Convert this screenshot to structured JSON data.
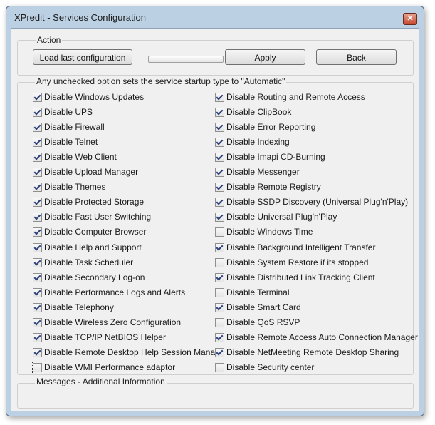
{
  "window": {
    "title": "XPredit - Services Configuration",
    "close_glyph": "✕"
  },
  "action_group": {
    "label": "Action",
    "load_label": "Load last configuration",
    "progress": 0,
    "apply_label": "Apply",
    "back_label": "Back"
  },
  "options_group": {
    "label": "Any unchecked option sets the service startup type to \"Automatic\""
  },
  "left_options": [
    {
      "label": "Disable Windows Updates",
      "checked": true
    },
    {
      "label": "Disable UPS",
      "checked": true
    },
    {
      "label": "Disable Firewall",
      "checked": true
    },
    {
      "label": "Disable Telnet",
      "checked": true
    },
    {
      "label": " Disable Web Client",
      "checked": true
    },
    {
      "label": "Disable Upload Manager",
      "checked": true
    },
    {
      "label": "Disable Themes",
      "checked": true
    },
    {
      "label": "Disable Protected Storage",
      "checked": true
    },
    {
      "label": " Disable Fast User Switching",
      "checked": true
    },
    {
      "label": "Disable Computer Browser",
      "checked": true
    },
    {
      "label": "Disable Help and Support",
      "checked": true
    },
    {
      "label": "Disable Task Scheduler",
      "checked": true
    },
    {
      "label": "Disable Secondary Log-on",
      "checked": true
    },
    {
      "label": "Disable Performance Logs and Alerts",
      "checked": true
    },
    {
      "label": "Disable Telephony",
      "checked": true
    },
    {
      "label": "Disable Wireless Zero Configuration",
      "checked": true
    },
    {
      "label": "Disable TCP/IP NetBIOS Helper",
      "checked": true
    },
    {
      "label": "Disable Remote Desktop Help Session Manag",
      "checked": true
    },
    {
      "label": "Disable WMI Performance adaptor",
      "checked": false
    }
  ],
  "right_options": [
    {
      "label": "Disable Routing and Remote Access",
      "checked": true
    },
    {
      "label": "Disable ClipBook",
      "checked": true
    },
    {
      "label": "Disable Error Reporting",
      "checked": true
    },
    {
      "label": "Disable Indexing",
      "checked": true
    },
    {
      "label": "Disable Imapi CD-Burning",
      "checked": true
    },
    {
      "label": "Disable Messenger",
      "checked": true
    },
    {
      "label": "Disable Remote Registry",
      "checked": true
    },
    {
      "label": "Disable SSDP Discovery (Universal Plug'n'Play)",
      "checked": true
    },
    {
      "label": "Disable Universal Plug'n'Play",
      "checked": true
    },
    {
      "label": "Disable Windows Time",
      "checked": false
    },
    {
      "label": "Disable Background Intelligent Transfer",
      "checked": true
    },
    {
      "label": "Disable System Restore if its stopped",
      "checked": false
    },
    {
      "label": "Disable Distributed Link Tracking Client",
      "checked": true
    },
    {
      "label": "Disable Terminal",
      "checked": false
    },
    {
      "label": "Disable Smart Card",
      "checked": true
    },
    {
      "label": "Disable QoS RSVP",
      "checked": false
    },
    {
      "label": "Disable Remote Access Auto Connection Manager",
      "checked": true
    },
    {
      "label": "Disable NetMeeting Remote Desktop Sharing",
      "checked": true
    },
    {
      "label": "Disable Security center",
      "checked": false
    }
  ],
  "messages_group": {
    "label": "Messages - Additional Information"
  },
  "colors": {
    "window_frame": "#bcd0e4",
    "client_bg": "#f0f0f0",
    "close_button": "#c5472d"
  }
}
